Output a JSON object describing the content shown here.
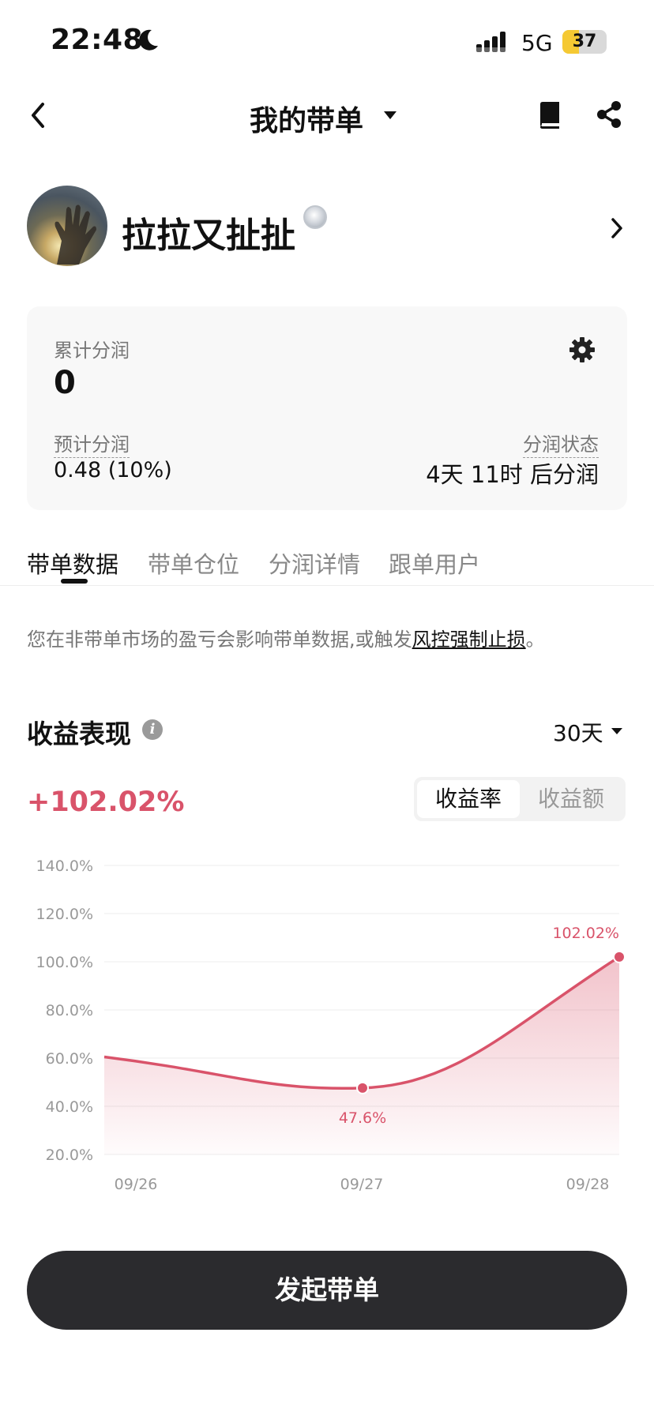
{
  "status_bar": {
    "time": "22:48",
    "network": "5G",
    "battery": "37",
    "battery_level": 0.37
  },
  "nav": {
    "title": "我的带单"
  },
  "profile": {
    "name": "拉拉又扯扯"
  },
  "earnings": {
    "cumulative_label": "累计分润",
    "cumulative_value": "0",
    "estimated_label": "预计分润",
    "estimated_value": "0.48 (10%)",
    "status_label": "分润状态",
    "status_value": "4天 11时 后分润"
  },
  "tabs": [
    {
      "label": "带单数据",
      "active": true
    },
    {
      "label": "带单仓位",
      "active": false
    },
    {
      "label": "分润详情",
      "active": false
    },
    {
      "label": "跟单用户",
      "active": false
    }
  ],
  "notice": {
    "text": "您在非带单市场的盈亏会影响带单数据,或触发",
    "link": "风控强制止损",
    "suffix": "。"
  },
  "performance": {
    "title": "收益表现",
    "period": "30天",
    "value": "+102.02%",
    "toggle": [
      {
        "label": "收益率",
        "selected": true
      },
      {
        "label": "收益额",
        "selected": false
      }
    ]
  },
  "chart_data": {
    "type": "area",
    "x": [
      "09/26",
      "09/27",
      "09/28"
    ],
    "series": [
      {
        "values": [
          60.5,
          47.6,
          102.02
        ]
      }
    ],
    "y_ticks": [
      "140.0%",
      "120.0%",
      "100.0%",
      "80.0%",
      "60.0%",
      "40.0%",
      "20.0%"
    ],
    "ylim": [
      20,
      140
    ],
    "annotations": [
      {
        "x": "09/27",
        "label": "47.6%"
      },
      {
        "x": "09/28",
        "label": "102.02%"
      }
    ],
    "grid": true,
    "color": "#d9536a"
  },
  "cta": {
    "label": "发起带单"
  },
  "colors": {
    "accent": "#d9536a",
    "button_bg": "#2b2b2e"
  }
}
